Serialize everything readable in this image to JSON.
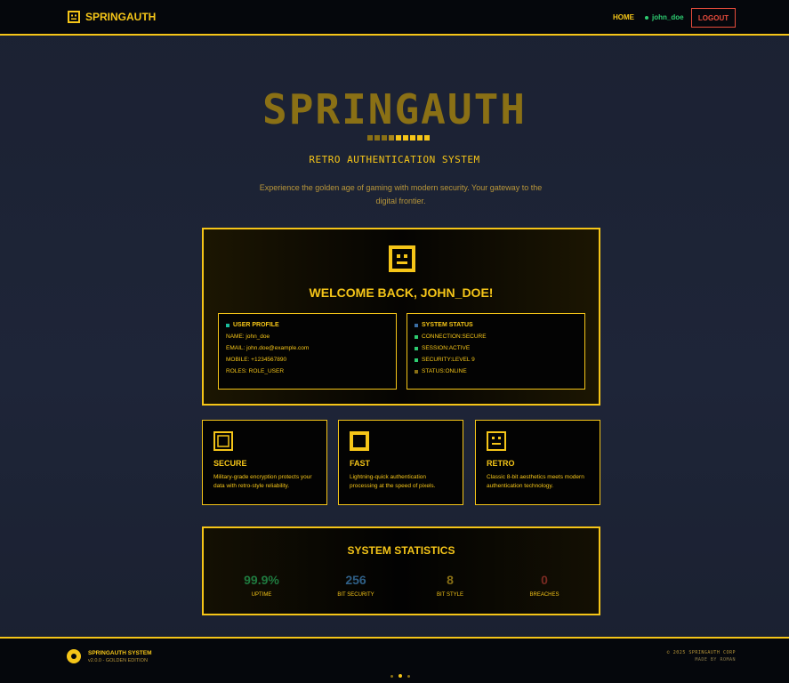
{
  "nav": {
    "brand": "SPRINGAUTH",
    "brand_icon": "robot-face-icon",
    "home": "HOME",
    "user": "john_doe",
    "logout": "LOGOUT"
  },
  "hero": {
    "title": "SPRINGAUTH",
    "subtitle": "RETRO AUTHENTICATION SYSTEM",
    "description": "Experience the golden age of gaming with modern security. Your gateway to the digital frontier."
  },
  "welcome": {
    "icon": "robot-face-icon",
    "title": "WELCOME BACK, JOHN_DOE!",
    "profile": {
      "heading": "USER PROFILE",
      "lines": [
        "NAME: john_doe",
        "EMAIL: john.doe@example.com",
        "MOBILE: +1234567890",
        "ROLES: ROLE_USER"
      ]
    },
    "status": {
      "heading": "SYSTEM STATUS",
      "lines": [
        "CONNECTION:SECURE",
        "SESSION:ACTIVE",
        "SECURITY:LEVEL 9",
        "STATUS:ONLINE"
      ]
    }
  },
  "features": [
    {
      "icon": "shield-square-icon",
      "title": "SECURE",
      "description": "Military-grade encryption protects your data with retro-style reliability."
    },
    {
      "icon": "lightning-square-icon",
      "title": "FAST",
      "description": "Lightning-quick authentication processing at the speed of pixels."
    },
    {
      "icon": "retro-face-icon",
      "title": "RETRO",
      "description": "Classic 8-bit aesthetics meets modern authentication technology."
    }
  ],
  "stats": {
    "title": "SYSTEM STATISTICS",
    "items": [
      {
        "value": "99.9%",
        "label": "UPTIME",
        "color": "#1f7a3f"
      },
      {
        "value": "256",
        "label": "BIT SECURITY",
        "color": "#2f5f86"
      },
      {
        "value": "8",
        "label": "BIT STYLE",
        "color": "#8a7015"
      },
      {
        "value": "0",
        "label": "BREACHES",
        "color": "#7a2a22"
      }
    ]
  },
  "footer": {
    "name": "SPRINGAUTH SYSTEM",
    "version": "v2.0.0 - GOLDEN EDITION",
    "copyright": "© 2025 SPRINGAUTH CORP",
    "made_by": "MADE BY ROMAN"
  },
  "colors": {
    "accent": "#f5c518",
    "green": "#2ecc71",
    "red": "#e74c3c",
    "background": "#1e2538"
  }
}
